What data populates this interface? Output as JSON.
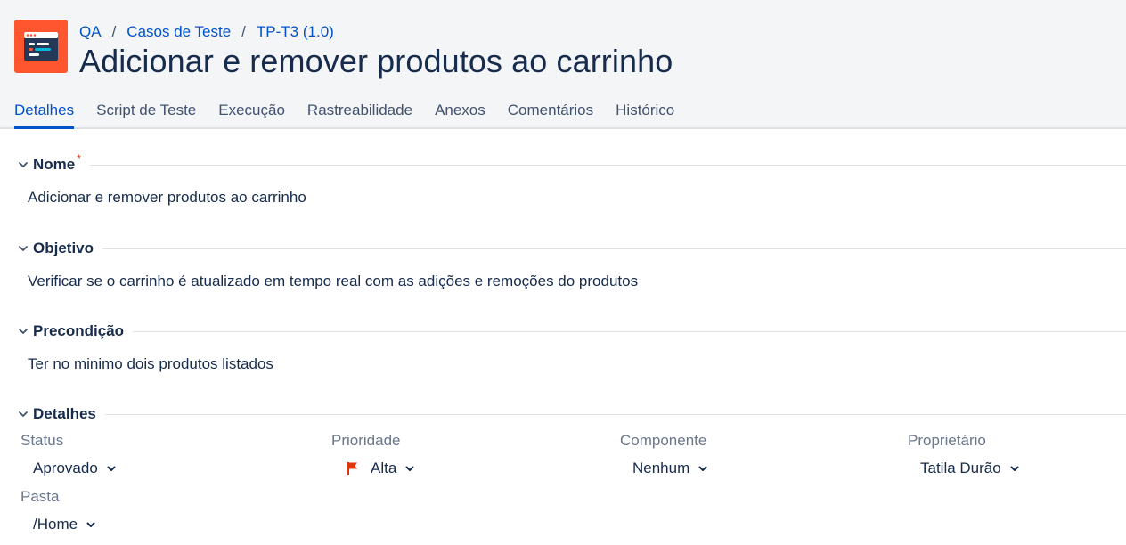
{
  "breadcrumb": {
    "project": "QA",
    "folder": "Casos de Teste",
    "item": "TP-T3 (1.0)",
    "separator": "/"
  },
  "page_title": "Adicionar e remover produtos ao carrinho",
  "tabs": [
    {
      "label": "Detalhes",
      "active": true
    },
    {
      "label": "Script de Teste",
      "active": false
    },
    {
      "label": "Execução",
      "active": false
    },
    {
      "label": "Rastreabilidade",
      "active": false
    },
    {
      "label": "Anexos",
      "active": false
    },
    {
      "label": "Comentários",
      "active": false
    },
    {
      "label": "Histórico",
      "active": false
    }
  ],
  "sections": {
    "nome": {
      "title": "Nome",
      "required_mark": "*",
      "text": "Adicionar e remover produtos ao carrinho"
    },
    "objetivo": {
      "title": "Objetivo",
      "text": "Verificar se o carrinho é atualizado em tempo real com as adições e remoções do produtos"
    },
    "precondicao": {
      "title": "Precondição",
      "text": "Ter no minimo dois produtos listados"
    },
    "detalhes": {
      "title": "Detalhes"
    }
  },
  "fields": {
    "status": {
      "label": "Status",
      "value": "Aprovado"
    },
    "prioridade": {
      "label": "Prioridade",
      "value": "Alta",
      "flag_color": "#de350b"
    },
    "componente": {
      "label": "Componente",
      "value": "Nenhum"
    },
    "proprietario": {
      "label": "Proprietário",
      "value": "Tatila Durão"
    },
    "pasta": {
      "label": "Pasta",
      "value": "/Home"
    }
  },
  "colors": {
    "accent": "#0052cc",
    "app_icon_bg": "#ff5630",
    "header_bg": "#f4f5f7",
    "text": "#172b4d"
  },
  "icons": {
    "app": "test-case-app-icon",
    "section_toggle": "chevron-down-icon",
    "dropdown": "chevron-down-icon",
    "priority": "flag-icon"
  }
}
